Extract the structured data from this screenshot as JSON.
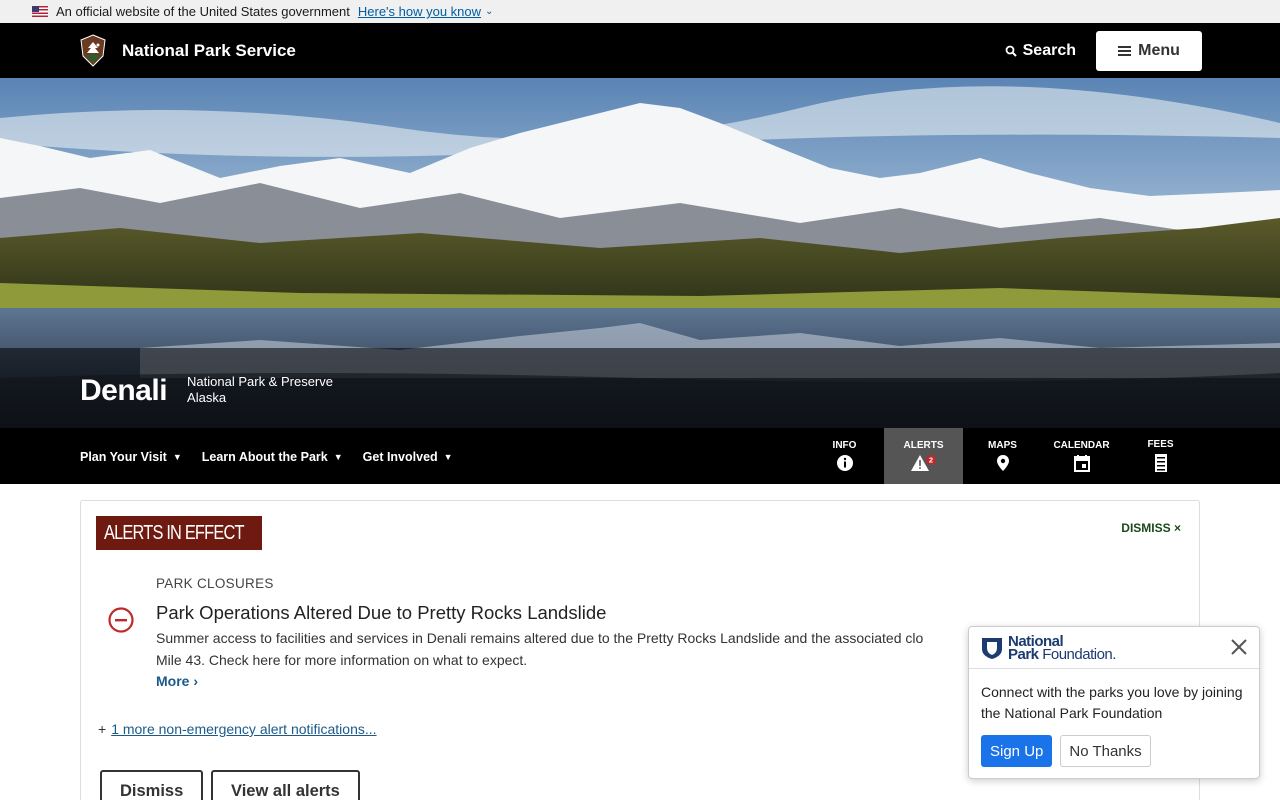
{
  "gov_banner": {
    "text": "An official website of the United States government",
    "link": "Here's how you know"
  },
  "header": {
    "brand": "National Park Service",
    "search_label": "Search",
    "menu_label": "Menu"
  },
  "hero": {
    "park_name": "Denali",
    "designation": "National Park & Preserve",
    "state": "Alaska"
  },
  "park_nav": {
    "items": [
      {
        "label": "Plan Your Visit"
      },
      {
        "label": "Learn About the Park"
      },
      {
        "label": "Get Involved"
      }
    ],
    "tabs": [
      {
        "label": "INFO",
        "icon": "info-icon"
      },
      {
        "label": "ALERTS",
        "icon": "alert-icon",
        "badge": "2",
        "active": true
      },
      {
        "label": "MAPS",
        "icon": "map-pin-icon"
      },
      {
        "label": "CALENDAR",
        "icon": "calendar-icon"
      },
      {
        "label": "FEES",
        "icon": "receipt-icon"
      }
    ]
  },
  "alerts": {
    "heading": "ALERTS IN EFFECT",
    "dismiss_x_label": "DISMISS",
    "category": "PARK CLOSURES",
    "title": "Park Operations Altered Due to Pretty Rocks Landslide",
    "body_line1": "Summer access to facilities and services in Denali remains altered due to the Pretty Rocks Landslide and the associated clo",
    "body_line2": "Mile 43. Check here for more information on what to expect.",
    "more_label": "More ›",
    "more_notifications_prefix": "+",
    "more_notifications": "1 more non-emergency alert notifications...",
    "dismiss_button": "Dismiss",
    "view_all_button": "View all alerts",
    "accent_color": "#6f1a10"
  },
  "popup": {
    "logo_line1": "National",
    "logo_line2": "Park",
    "logo_line2b": "Foundation.",
    "message": "Connect with the parks you love by joining the National Park Foundation",
    "signup_label": "Sign Up",
    "no_thanks_label": "No Thanks"
  }
}
